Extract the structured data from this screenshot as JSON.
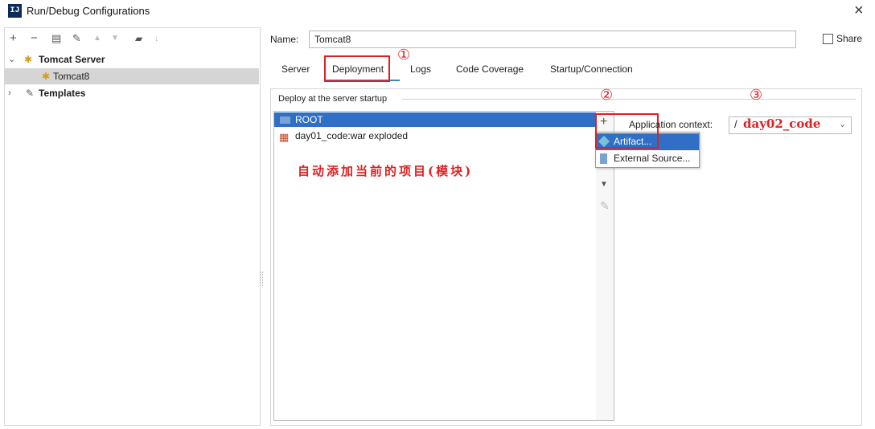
{
  "window": {
    "title": "Run/Debug Configurations",
    "app_icon_text": "IJ",
    "close_glyph": "×"
  },
  "toolbar": {
    "icons": [
      "add-icon",
      "remove-icon",
      "copy-icon",
      "wrench-icon",
      "move-up-icon",
      "move-down-icon",
      "folder-icon",
      "sort-icon"
    ]
  },
  "tree": {
    "groups": [
      {
        "label": "Tomcat Server",
        "expanded": true,
        "children": [
          {
            "label": "Tomcat8",
            "selected": true
          }
        ]
      },
      {
        "label": "Templates",
        "expanded": false
      }
    ]
  },
  "config": {
    "name_label": "Name:",
    "name_value": "Tomcat8",
    "share_label": "Share",
    "share_checked": false
  },
  "tabs": [
    {
      "label": "Server",
      "active": false
    },
    {
      "label": "Deployment",
      "active": true
    },
    {
      "label": "Logs",
      "active": false
    },
    {
      "label": "Code Coverage",
      "active": false
    },
    {
      "label": "Startup/Connection",
      "active": false
    }
  ],
  "deployment": {
    "group_title": "Deploy at the server startup",
    "items": [
      {
        "label": "ROOT",
        "selected": true
      },
      {
        "label": "day01_code:war exploded",
        "selected": false
      }
    ],
    "annotation_cn": "自动添加当前的项目(模块)",
    "add_menu": {
      "items": [
        {
          "label": "Artifact...",
          "selected": true
        },
        {
          "label": "External Source...",
          "selected": false
        }
      ]
    },
    "context_label": "Application context:",
    "context_slash": "/",
    "context_value": "day02_code"
  },
  "annotations": {
    "step1": "①",
    "step2": "②",
    "step3": "③"
  },
  "colors": {
    "accent": "#2f6fc6",
    "annotation_red": "#e02020",
    "tab_underline": "#4083c9"
  }
}
